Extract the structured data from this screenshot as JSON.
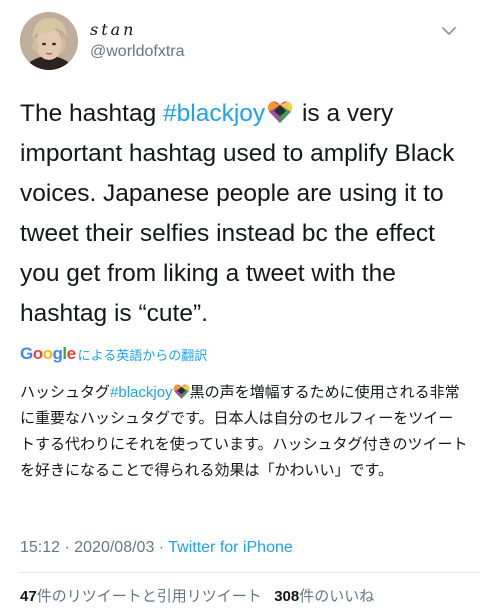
{
  "user": {
    "display_name": "stan",
    "handle": "@worldofxtra"
  },
  "tweet": {
    "text_part1": "The hashtag ",
    "hashtag": "#blackjoy",
    "text_part2": " is a very important hashtag used to amplify Black voices. Japanese people are using it to tweet their selfies instead bc the effect you get from liking a tweet with the hashtag is “cute”."
  },
  "translation": {
    "google_label": "Google",
    "label": "による英語からの翻訳",
    "text_part1": "ハッシュタグ",
    "hashtag": "#blackjoy",
    "text_part2": "黒の声を増幅するために使用される非常に重要なハッシュタグです。日本人は自分のセルフィーをツイートする代わりにそれを使っています。ハッシュタグ付きのツイートを好きになることで得られる効果は「かわいい」です。"
  },
  "meta": {
    "time": "15:12 · 2020/08/03 · ",
    "source": "Twitter for iPhone"
  },
  "stats": {
    "retweets_count": "47",
    "retweets_label": "件のリツイートと引用リツイート",
    "likes_count": "308",
    "likes_label": "件のいいね"
  },
  "colors": {
    "link": "#1da1f2",
    "secondary_text": "#657786",
    "google": [
      "#4285f4",
      "#ea4335",
      "#fbbc05",
      "#4285f4",
      "#34a853",
      "#ea4335"
    ]
  }
}
